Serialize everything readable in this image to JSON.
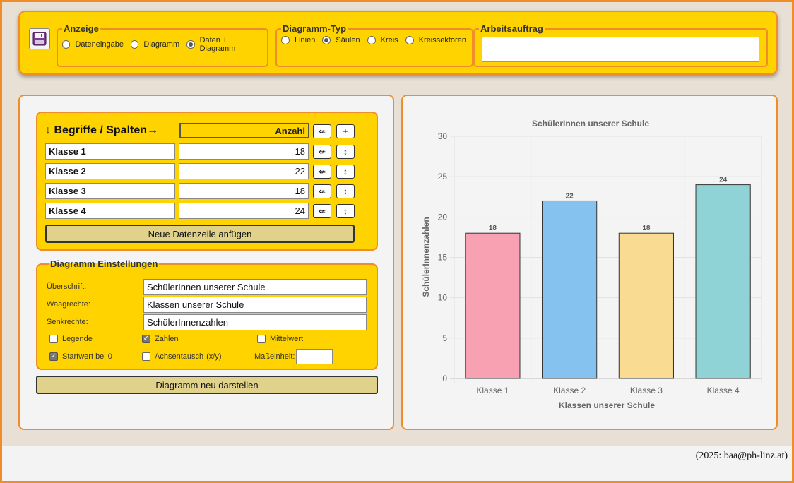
{
  "toolbar": {
    "anzeige": {
      "legend": "Anzeige",
      "options": [
        "Dateneingabe",
        "Diagramm",
        "Daten + Diagramm"
      ],
      "selected": 2
    },
    "typ": {
      "legend": "Diagramm-Typ",
      "options": [
        "Linien",
        "Säulen",
        "Kreis",
        "Kreissektoren"
      ],
      "selected": 1
    },
    "auftrag": {
      "legend": "Arbeitsauftrag",
      "value": ""
    }
  },
  "data_table": {
    "header_label": "↓ Begriffe / Spalten→",
    "count_header": "Anzahl",
    "rows": [
      {
        "name": "Klasse 1",
        "value": "18"
      },
      {
        "name": "Klasse 2",
        "value": "22"
      },
      {
        "name": "Klasse 3",
        "value": "18"
      },
      {
        "name": "Klasse 4",
        "value": "24"
      }
    ],
    "swap_symbol": "⇍",
    "move_symbol": "↕",
    "add_col_symbol": "+",
    "add_row_label": "Neue Datenzeile anfügen"
  },
  "settings": {
    "legend": "Diagramm Einstellungen",
    "title_label": "Überschrift:",
    "title_value": "SchülerInnen unserer Schule",
    "x_label": "Waagrechte:",
    "x_value": "Klassen unserer Schule",
    "y_label": "Senkrechte:",
    "y_value": "SchülerInnenzahlen",
    "legende": {
      "label": "Legende",
      "checked": false
    },
    "zahlen": {
      "label": "Zahlen",
      "checked": true
    },
    "mittelwert": {
      "label": "Mittelwert",
      "checked": false
    },
    "startwert": {
      "label": "Startwert bei 0",
      "checked": true
    },
    "achsentausch": {
      "label": "Achsentausch",
      "suffix": "(x/y)",
      "checked": false
    },
    "unit_label": "Maßeinheit:",
    "unit_value": "",
    "redraw_label": "Diagramm neu darstellen"
  },
  "chart_data": {
    "type": "bar",
    "title": "SchülerInnen unserer Schule",
    "xlabel": "Klassen unserer Schule",
    "ylabel": "SchülerInnenzahlen",
    "categories": [
      "Klasse 1",
      "Klasse 2",
      "Klasse 3",
      "Klasse 4"
    ],
    "values": [
      18,
      22,
      18,
      24
    ],
    "ylim": [
      0,
      30
    ],
    "yticks": [
      0,
      5,
      10,
      15,
      20,
      25,
      30
    ],
    "data_labels": true,
    "grid": true,
    "colors": [
      "#f7a1b3",
      "#86c2ef",
      "#f9dc92",
      "#8fd3d6"
    ]
  },
  "footer": {
    "credit": "(2025: baa@ph-linz.at)"
  }
}
